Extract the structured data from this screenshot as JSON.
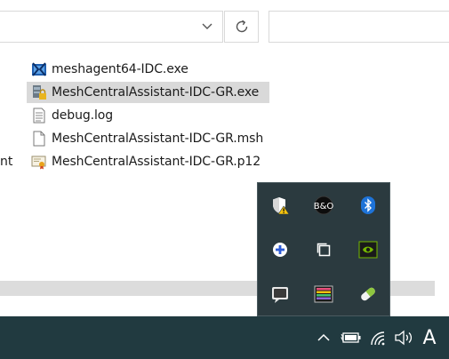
{
  "explorer": {
    "left_fragment": "nt",
    "files": [
      {
        "name": "meshagent64-IDC.exe",
        "icon": "mesh-agent-icon",
        "selected": false
      },
      {
        "name": "MeshCentralAssistant-IDC-GR.exe",
        "icon": "mesh-assistant-icon",
        "selected": true
      },
      {
        "name": "debug.log",
        "icon": "text-file-icon",
        "selected": false
      },
      {
        "name": "MeshCentralAssistant-IDC-GR.msh",
        "icon": "blank-file-icon",
        "selected": false
      },
      {
        "name": "MeshCentralAssistant-IDC-GR.p12",
        "icon": "certificate-icon",
        "selected": false
      }
    ]
  },
  "tray_popup": {
    "items": [
      {
        "icon": "security-shield-warning-icon"
      },
      {
        "icon": "bang-olufsen-icon"
      },
      {
        "icon": "bluetooth-icon"
      },
      {
        "icon": "mesh-plus-icon"
      },
      {
        "icon": "copy-windows-icon"
      },
      {
        "icon": "nvidia-icon"
      },
      {
        "icon": "chat-bubble-icon"
      },
      {
        "icon": "color-grid-icon"
      },
      {
        "icon": "pill-icon"
      }
    ]
  },
  "taskbar": {
    "input_indicator": "A"
  }
}
